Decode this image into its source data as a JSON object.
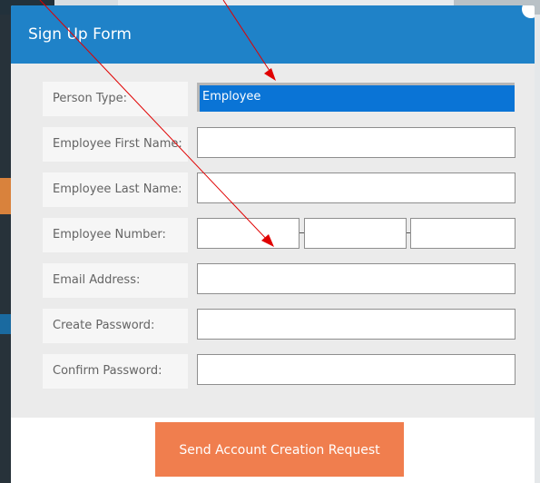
{
  "modal": {
    "title": "Sign Up Form",
    "submit_label": "Send Account Creation Request"
  },
  "form": {
    "person_type": {
      "label": "Person Type:",
      "value": "Employee"
    },
    "first_name": {
      "label": "Employee First Name:",
      "value": ""
    },
    "last_name": {
      "label": "Employee Last Name:",
      "value": ""
    },
    "employee_number": {
      "label": "Employee Number:",
      "segments": [
        "",
        "",
        ""
      ]
    },
    "email": {
      "label": "Email Address:",
      "value": ""
    },
    "password": {
      "label": "Create Password:",
      "value": ""
    },
    "confirm_password": {
      "label": "Confirm Password:",
      "value": ""
    }
  },
  "colors": {
    "header": "#1f82c8",
    "selection": "#0a74d6",
    "submit": "#f07e4e",
    "annotation_arrow": "#e00000"
  }
}
